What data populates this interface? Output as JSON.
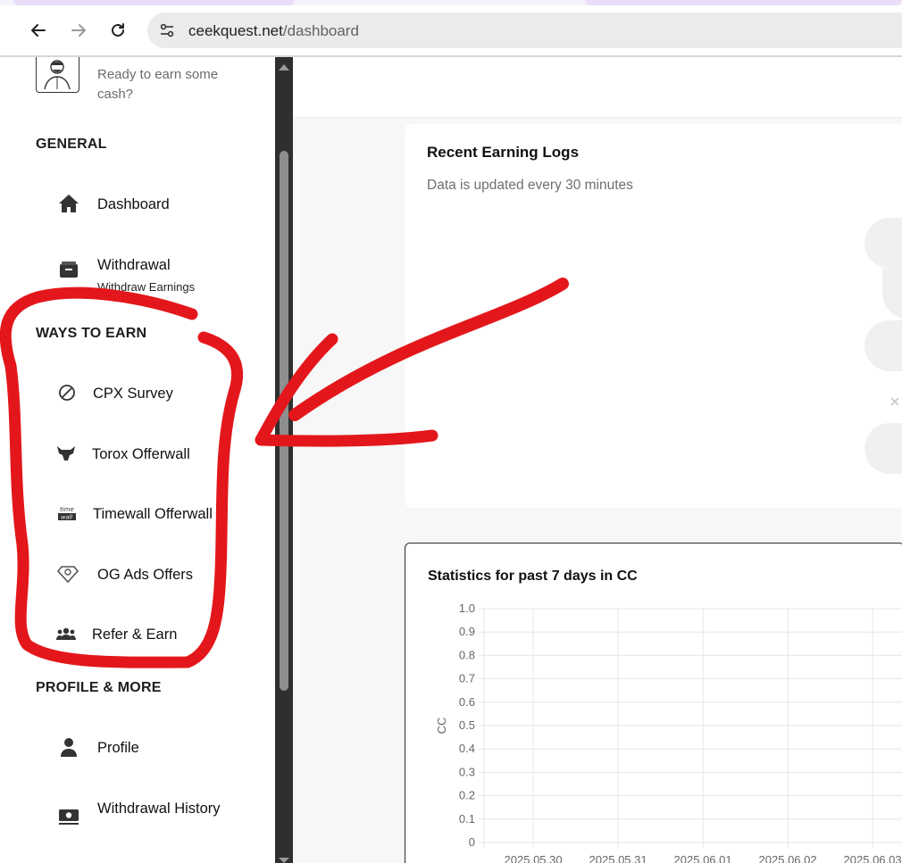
{
  "browser": {
    "url_host": "ceekquest.net",
    "url_path": "/dashboard"
  },
  "sidebar": {
    "greeting": "Ready to earn some cash?",
    "sections": {
      "general": "GENERAL",
      "ways_to_earn": "WAYS TO EARN",
      "profile_more": "PROFILE & MORE"
    },
    "items": [
      {
        "label": "Dashboard",
        "icon": "home-icon"
      },
      {
        "label": "Withdrawal",
        "sublabel": "Withdraw Earnings",
        "icon": "wallet-icon"
      },
      {
        "label": "CPX Survey",
        "icon": "cpx-icon"
      },
      {
        "label": "Torox Offerwall",
        "icon": "torox-icon"
      },
      {
        "label": "Timewall Offerwall",
        "icon": "timewall-icon"
      },
      {
        "label": "OG Ads Offers",
        "icon": "ogads-icon"
      },
      {
        "label": "Refer & Earn",
        "icon": "users-icon"
      },
      {
        "label": "Profile",
        "icon": "user-icon"
      },
      {
        "label": "Withdrawal History",
        "icon": "money-icon"
      }
    ]
  },
  "recent_logs": {
    "title": "Recent Earning Logs",
    "subtitle": "Data is updated every 30 minutes"
  },
  "stats": {
    "title": "Statistics for past 7 days in CC"
  },
  "colors": {
    "annotation": "#e3171b",
    "scrollbar": "#2f2f2f"
  },
  "chart_data": {
    "type": "line",
    "title": "Statistics for past 7 days in CC",
    "ylabel": "CC",
    "xlabel": "",
    "ylim": [
      0,
      1.0
    ],
    "yticks": [
      "1.0",
      "0.9",
      "0.8",
      "0.7",
      "0.6",
      "0.5",
      "0.4",
      "0.3",
      "0.2",
      "0.1",
      "0"
    ],
    "categories": [
      "2025.05.30",
      "2025.05.31",
      "2025.06.01",
      "2025.06.02",
      "2025.06.03"
    ],
    "grid": true,
    "series": []
  }
}
